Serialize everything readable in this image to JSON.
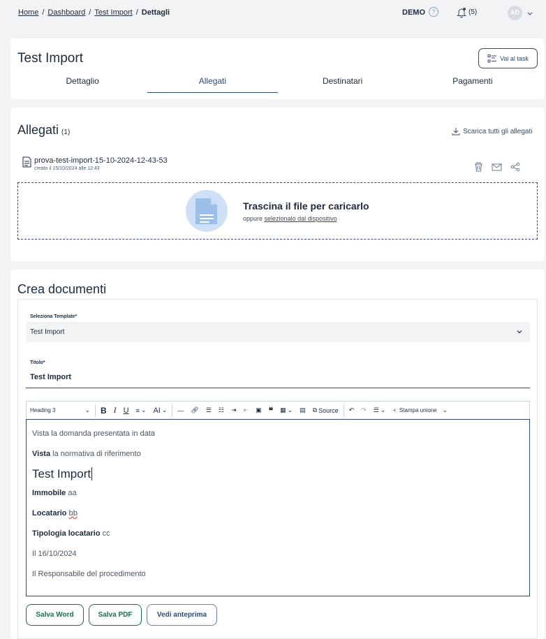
{
  "breadcrumb": [
    "Home",
    "Dashboard",
    "Test Import",
    "Dettagli"
  ],
  "header": {
    "env": "DEMO",
    "help_glyph": "?",
    "notifications": "(5)",
    "avatar": "AD"
  },
  "page": {
    "title": "Test Import",
    "task_button": "Vai al task",
    "tabs": [
      "Dettaglio",
      "Allegati",
      "Destinatari",
      "Pagamenti"
    ],
    "active_tab": "Allegati"
  },
  "attachments": {
    "title": "Allegati",
    "count": "(1)",
    "download_all": "Scarica tutti gli allegati",
    "file": {
      "name": "prova-test-import-15-10-2024-12-43-53",
      "meta": "creato il 15/10/2024 alle 12:43"
    },
    "drop_title": "Trascina il file per caricarlo",
    "drop_or": "oppure",
    "drop_link": "selezionalo dal dispositivo"
  },
  "create": {
    "title": "Crea documenti",
    "template_label": "Seleziona Template*",
    "template_value": "Test Import",
    "title_label": "Titolo*",
    "title_value": "Test Import",
    "toolbar": {
      "heading": "Heading 3",
      "bold": "B",
      "italic": "I",
      "underline": "U",
      "font_size": "AI",
      "source": "Source",
      "merge": "Stampa unione"
    },
    "editor": {
      "line1": "Vista la domanda presentata in data",
      "line2_bold": "Vista",
      "line2_rest": " la normativa di riferimento",
      "heading": "Test Import",
      "line3_bold": "Immobile",
      "line3_rest": " aa",
      "line4_bold": "Locatario",
      "line4_rest": "bb",
      "line5_bold": "Tipologia locatario",
      "line5_rest": " cc",
      "line6": "Il 16/10/2024",
      "line7": "Il Responsabile del procedimento"
    },
    "buttons": {
      "word": "Salva Word",
      "pdf": "Salva PDF",
      "preview": "Vedi anteprima"
    }
  }
}
